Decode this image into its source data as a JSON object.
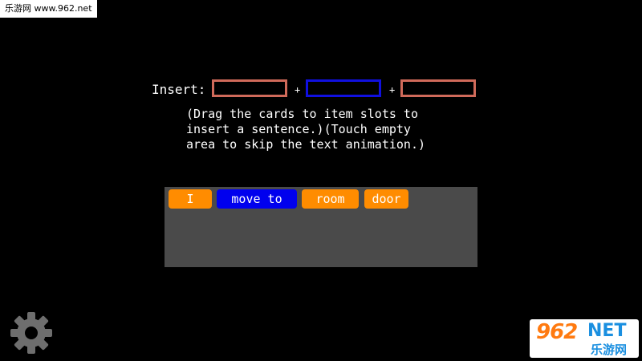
{
  "watermark": {
    "text": "乐游网 www.962.net"
  },
  "insert": {
    "label": "Insert:",
    "plus1": "+",
    "plus2": "+"
  },
  "instructions": "(Drag the cards to item slots to\ninsert a sentence.)(Touch empty\narea to skip the text animation.)",
  "cards": [
    {
      "label": "I",
      "color": "#ff8c00"
    },
    {
      "label": "move to",
      "color": "#0000ee"
    },
    {
      "label": "room",
      "color": "#ff8c00"
    },
    {
      "label": "door",
      "color": "#ff8c00"
    }
  ],
  "settings": {
    "icon": "gear-icon"
  },
  "logo": {
    "num": "962",
    "net": "NET",
    "cn": "乐游网"
  }
}
